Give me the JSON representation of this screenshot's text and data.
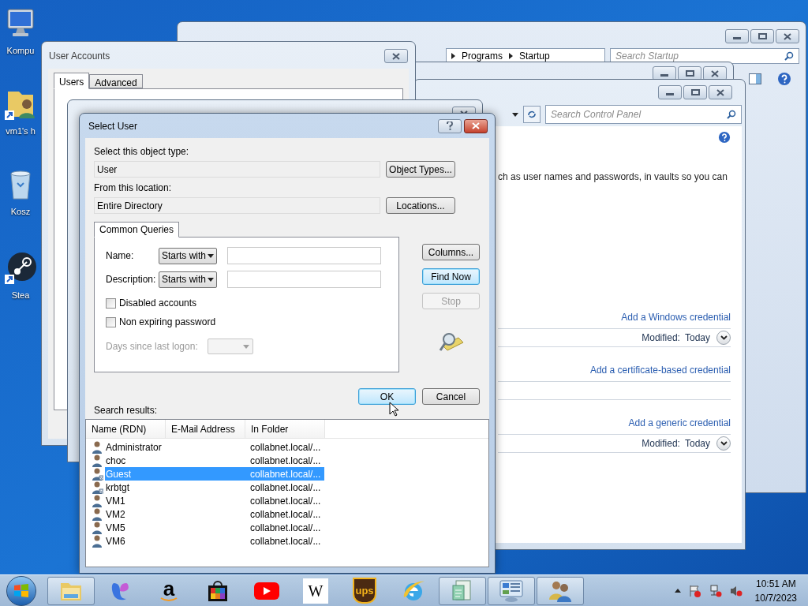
{
  "desktop_icons": [
    {
      "label": "Kompu",
      "kind": "computer"
    },
    {
      "label": "vm1's h",
      "kind": "folder"
    },
    {
      "label": "Kosz",
      "kind": "recycle"
    },
    {
      "label": "Stea",
      "kind": "steam"
    }
  ],
  "startup_window": {
    "breadcrumb": [
      "Programs",
      "Startup"
    ],
    "search": {
      "placeholder": "Search Startup"
    }
  },
  "control_panel_window": {
    "search": {
      "placeholder": "Search Control Panel"
    },
    "description": "ch as user names and passwords, in vaults so you can",
    "sections": [
      {
        "link": "Add a Windows credential",
        "modified_label": "Modified:",
        "modified_value": "Today"
      },
      {
        "link": "Add a certificate-based credential"
      },
      {
        "link": "Add a generic credential",
        "modified_label": "Modified:",
        "modified_value": "Today"
      }
    ]
  },
  "user_accounts_window": {
    "title": "User Accounts",
    "tabs": [
      {
        "label": "Users",
        "selected": true
      },
      {
        "label": "Advanced",
        "selected": false
      }
    ]
  },
  "select_user_dialog": {
    "title": "Select User",
    "object_type_label": "Select this object type:",
    "object_type": "User",
    "object_types_button": "Object Types...",
    "location_label": "From this location:",
    "location": "Entire Directory",
    "locations_button": "Locations...",
    "query_tab": "Common Queries",
    "name_label": "Name:",
    "name_operator": "Starts with",
    "description_label": "Description:",
    "description_operator": "Starts with",
    "checkboxes": [
      {
        "label": "Disabled accounts",
        "checked": false
      },
      {
        "label": "Non expiring password",
        "checked": false
      }
    ],
    "days_label": "Days since last logon:",
    "days_disabled": true,
    "side_buttons": [
      {
        "label": "Columns...",
        "disabled": false,
        "default": false
      },
      {
        "label": "Find Now",
        "disabled": false,
        "default": true
      },
      {
        "label": "Stop",
        "disabled": true,
        "default": false
      }
    ],
    "ok_button": "OK",
    "cancel_button": "Cancel",
    "results_label": "Search results:",
    "columns": [
      "Name (RDN)",
      "E-Mail Address",
      "In Folder"
    ],
    "rows": [
      {
        "name": "Administrator",
        "folder": "collabnet.local/...",
        "selected": false,
        "disabled": false
      },
      {
        "name": "choc",
        "folder": "collabnet.local/...",
        "selected": false,
        "disabled": false
      },
      {
        "name": "Guest",
        "folder": "collabnet.local/...",
        "selected": true,
        "disabled": true
      },
      {
        "name": "krbtgt",
        "folder": "collabnet.local/...",
        "selected": false,
        "disabled": true
      },
      {
        "name": "VM1",
        "folder": "collabnet.local/...",
        "selected": false,
        "disabled": false
      },
      {
        "name": "VM2",
        "folder": "collabnet.local/...",
        "selected": false,
        "disabled": false
      },
      {
        "name": "VM5",
        "folder": "collabnet.local/...",
        "selected": false,
        "disabled": false
      },
      {
        "name": "VM6",
        "folder": "collabnet.local/...",
        "selected": false,
        "disabled": false
      }
    ]
  },
  "taskbar": {
    "items": [
      {
        "kind": "explorer",
        "running": true
      },
      {
        "kind": "copilot",
        "running": false
      },
      {
        "kind": "amazon",
        "glyph": "a",
        "running": false
      },
      {
        "kind": "store",
        "running": false
      },
      {
        "kind": "youtube",
        "running": false
      },
      {
        "kind": "wikipedia",
        "glyph": "W",
        "running": false
      },
      {
        "kind": "ups",
        "glyph": "ups",
        "running": false
      },
      {
        "kind": "ie",
        "running": false
      },
      {
        "kind": "document",
        "running": true
      },
      {
        "kind": "control-panel",
        "running": true
      },
      {
        "kind": "users",
        "running": true
      }
    ],
    "clock": {
      "time": "10:51 AM",
      "date": "10/7/2023"
    }
  }
}
